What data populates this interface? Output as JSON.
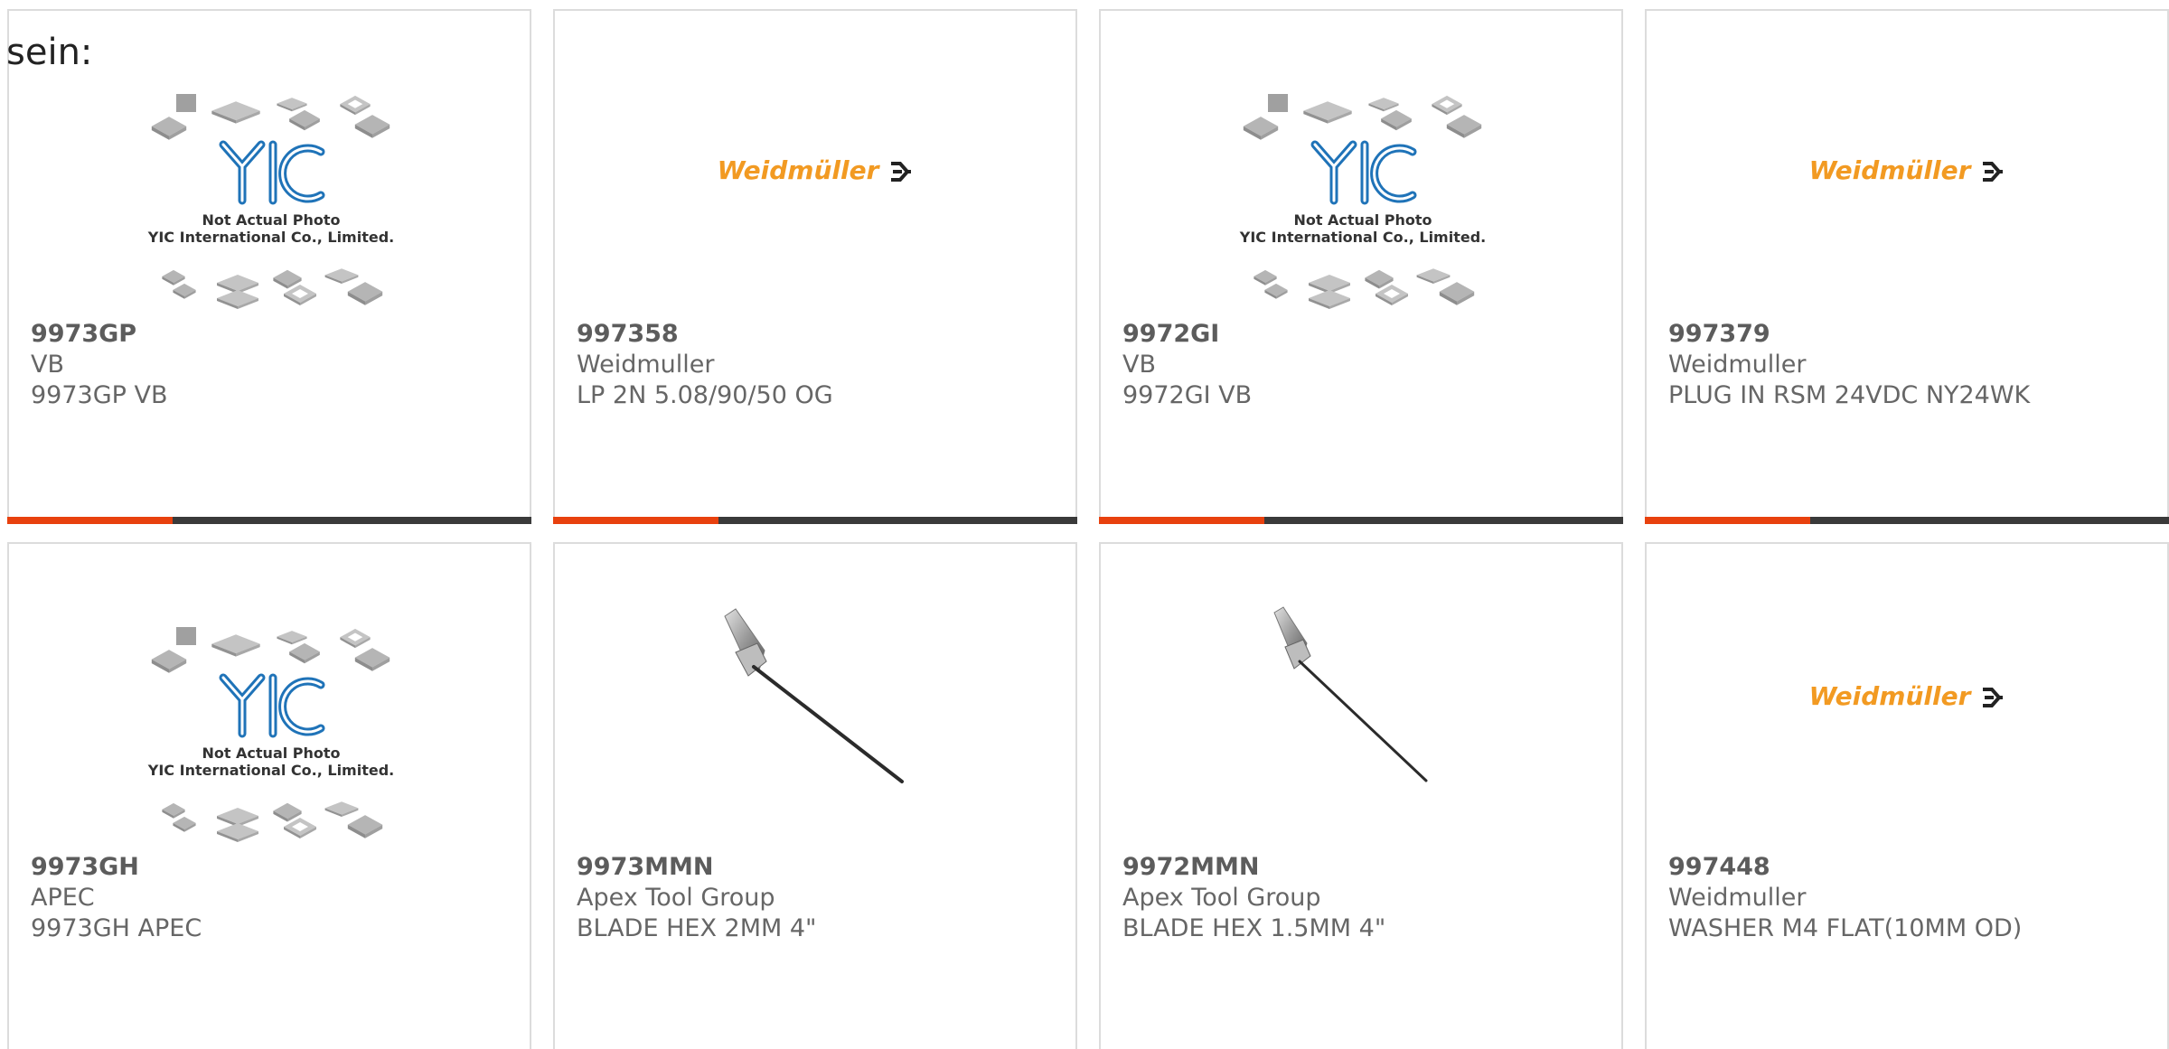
{
  "lead_text": "sein:",
  "logo_texts": {
    "weidmuller": "Weidmüller",
    "yic_letters": "YIC",
    "yic_caption_1": "Not Actual Photo",
    "yic_caption_2": "YIC International Co., Limited."
  },
  "products": [
    {
      "part": "9973GP",
      "brand": "VB",
      "desc": "9973GP VB",
      "image": "yic-placeholder"
    },
    {
      "part": "997358",
      "brand": "Weidmuller",
      "desc": "LP 2N 5.08/90/50 OG",
      "image": "weidmuller-logo"
    },
    {
      "part": "9972GI",
      "brand": "VB",
      "desc": "9972GI VB",
      "image": "yic-placeholder"
    },
    {
      "part": "997379",
      "brand": "Weidmuller",
      "desc": "PLUG IN RSM 24VDC NY24WK",
      "image": "weidmuller-logo"
    },
    {
      "part": "9973GH",
      "brand": "APEC",
      "desc": "9973GH APEC",
      "image": "yic-placeholder"
    },
    {
      "part": "9973MMN",
      "brand": "Apex Tool Group",
      "desc": "BLADE HEX 2MM 4\"",
      "image": "hex-blade"
    },
    {
      "part": "9972MMN",
      "brand": "Apex Tool Group",
      "desc": "BLADE HEX 1.5MM 4\"",
      "image": "hex-blade"
    },
    {
      "part": "997448",
      "brand": "Weidmuller",
      "desc": "WASHER M4 FLAT(10MM OD)",
      "image": "weidmuller-logo"
    }
  ],
  "colors": {
    "accent_red": "#e8410e",
    "bar_dark": "#3a3a3a",
    "weidmuller_orange": "#f29a22",
    "yic_blue": "#1f73b8"
  }
}
